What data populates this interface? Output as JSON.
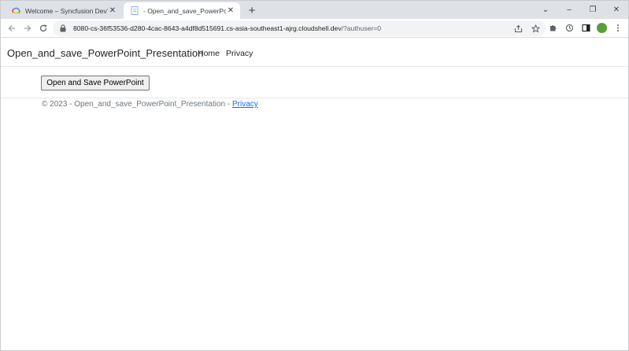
{
  "browser": {
    "tabs": [
      {
        "title": "Welcome – Syncfusion DevTest –",
        "close": "✕",
        "active": false,
        "icon": "google-cloud-icon"
      },
      {
        "title": "- Open_and_save_PowerPoint_Pr",
        "close": "✕",
        "active": true,
        "icon": "page-icon"
      }
    ],
    "new_tab": "+",
    "window_controls": {
      "collapse": "⌄",
      "minimize": "–",
      "restore": "❐",
      "close": "✕"
    },
    "url_host": "8080-cs-36f53536-d280-4cac-8643-a4df8d515691.cs-asia-southeast1-ajrg.cloudshell.dev",
    "url_path": "/?authuser=0",
    "profile_color": "#5a9e39"
  },
  "navbar": {
    "brand": "Open_and_save_PowerPoint_Presentation",
    "links": [
      "Home",
      "Privacy"
    ]
  },
  "main": {
    "button_label": "Open and Save PowerPoint"
  },
  "footer": {
    "text": "© 2023 - Open_and_save_PowerPoint_Presentation - ",
    "link": "Privacy"
  }
}
